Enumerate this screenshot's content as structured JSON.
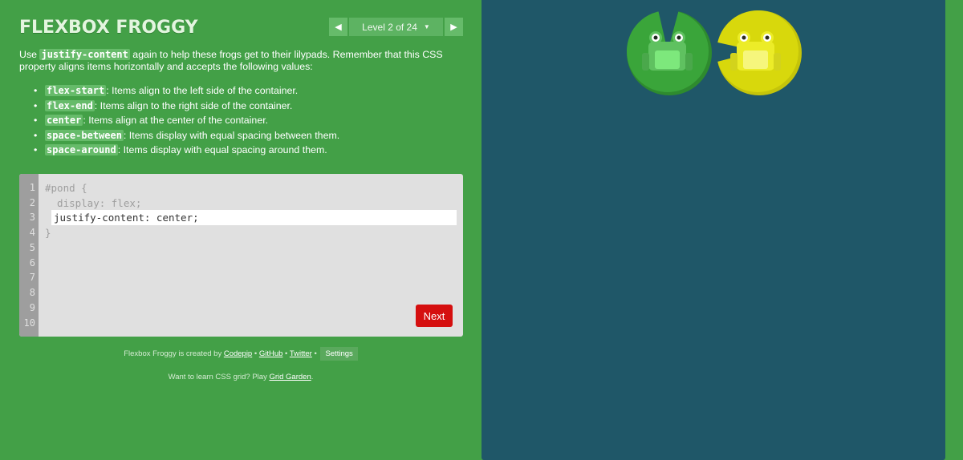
{
  "app": {
    "title": "FLEXBOX FROGGY"
  },
  "level_nav": {
    "prev_icon": "triangle-left-icon",
    "label": "Level 2 of 24",
    "dropdown_icon": "caret-down-icon",
    "next_icon": "triangle-right-icon"
  },
  "instructions": {
    "pre": "Use ",
    "keyword": "justify-content",
    "post": " again to help these frogs get to their lilypads. Remember that this CSS property aligns items horizontally and accepts the following values:",
    "values": [
      {
        "code": "flex-start",
        "desc": ": Items align to the left side of the container."
      },
      {
        "code": "flex-end",
        "desc": ": Items align to the right side of the container."
      },
      {
        "code": "center",
        "desc": ": Items align at the center of the container."
      },
      {
        "code": "space-between",
        "desc": ": Items display with equal spacing between them."
      },
      {
        "code": "space-around",
        "desc": ": Items display with equal spacing around them."
      }
    ]
  },
  "editor": {
    "line_numbers": [
      "1",
      "2",
      "3",
      "4",
      "5",
      "6",
      "7",
      "8",
      "9",
      "10"
    ],
    "line1": "#pond {",
    "line2": "  display: flex;",
    "input_value": "justify-content: center;",
    "line4": "}",
    "next_label": "Next"
  },
  "footer": {
    "credit_text": "Flexbox Froggy is created by ",
    "codepip": "Codepip",
    "sep": " • ",
    "github": "GitHub",
    "twitter": "Twitter",
    "settings": "Settings",
    "grid_text": "Want to learn CSS grid? Play ",
    "grid_link": "Grid Garden",
    "grid_end": "."
  },
  "board": {
    "frogs": [
      {
        "color": "green",
        "lilypad": "#3aa53a",
        "frog_body": "#5fc160",
        "frog_belly": "#7de87c"
      },
      {
        "color": "yellow",
        "lilypad": "#d8d80c",
        "frog_body": "#ecec28",
        "frog_belly": "#f6f67c"
      }
    ]
  },
  "colors": {
    "background": "#43a047",
    "pond": "#1f5768",
    "next_button": "#d50f0f",
    "editor": "#e0e0e0"
  }
}
